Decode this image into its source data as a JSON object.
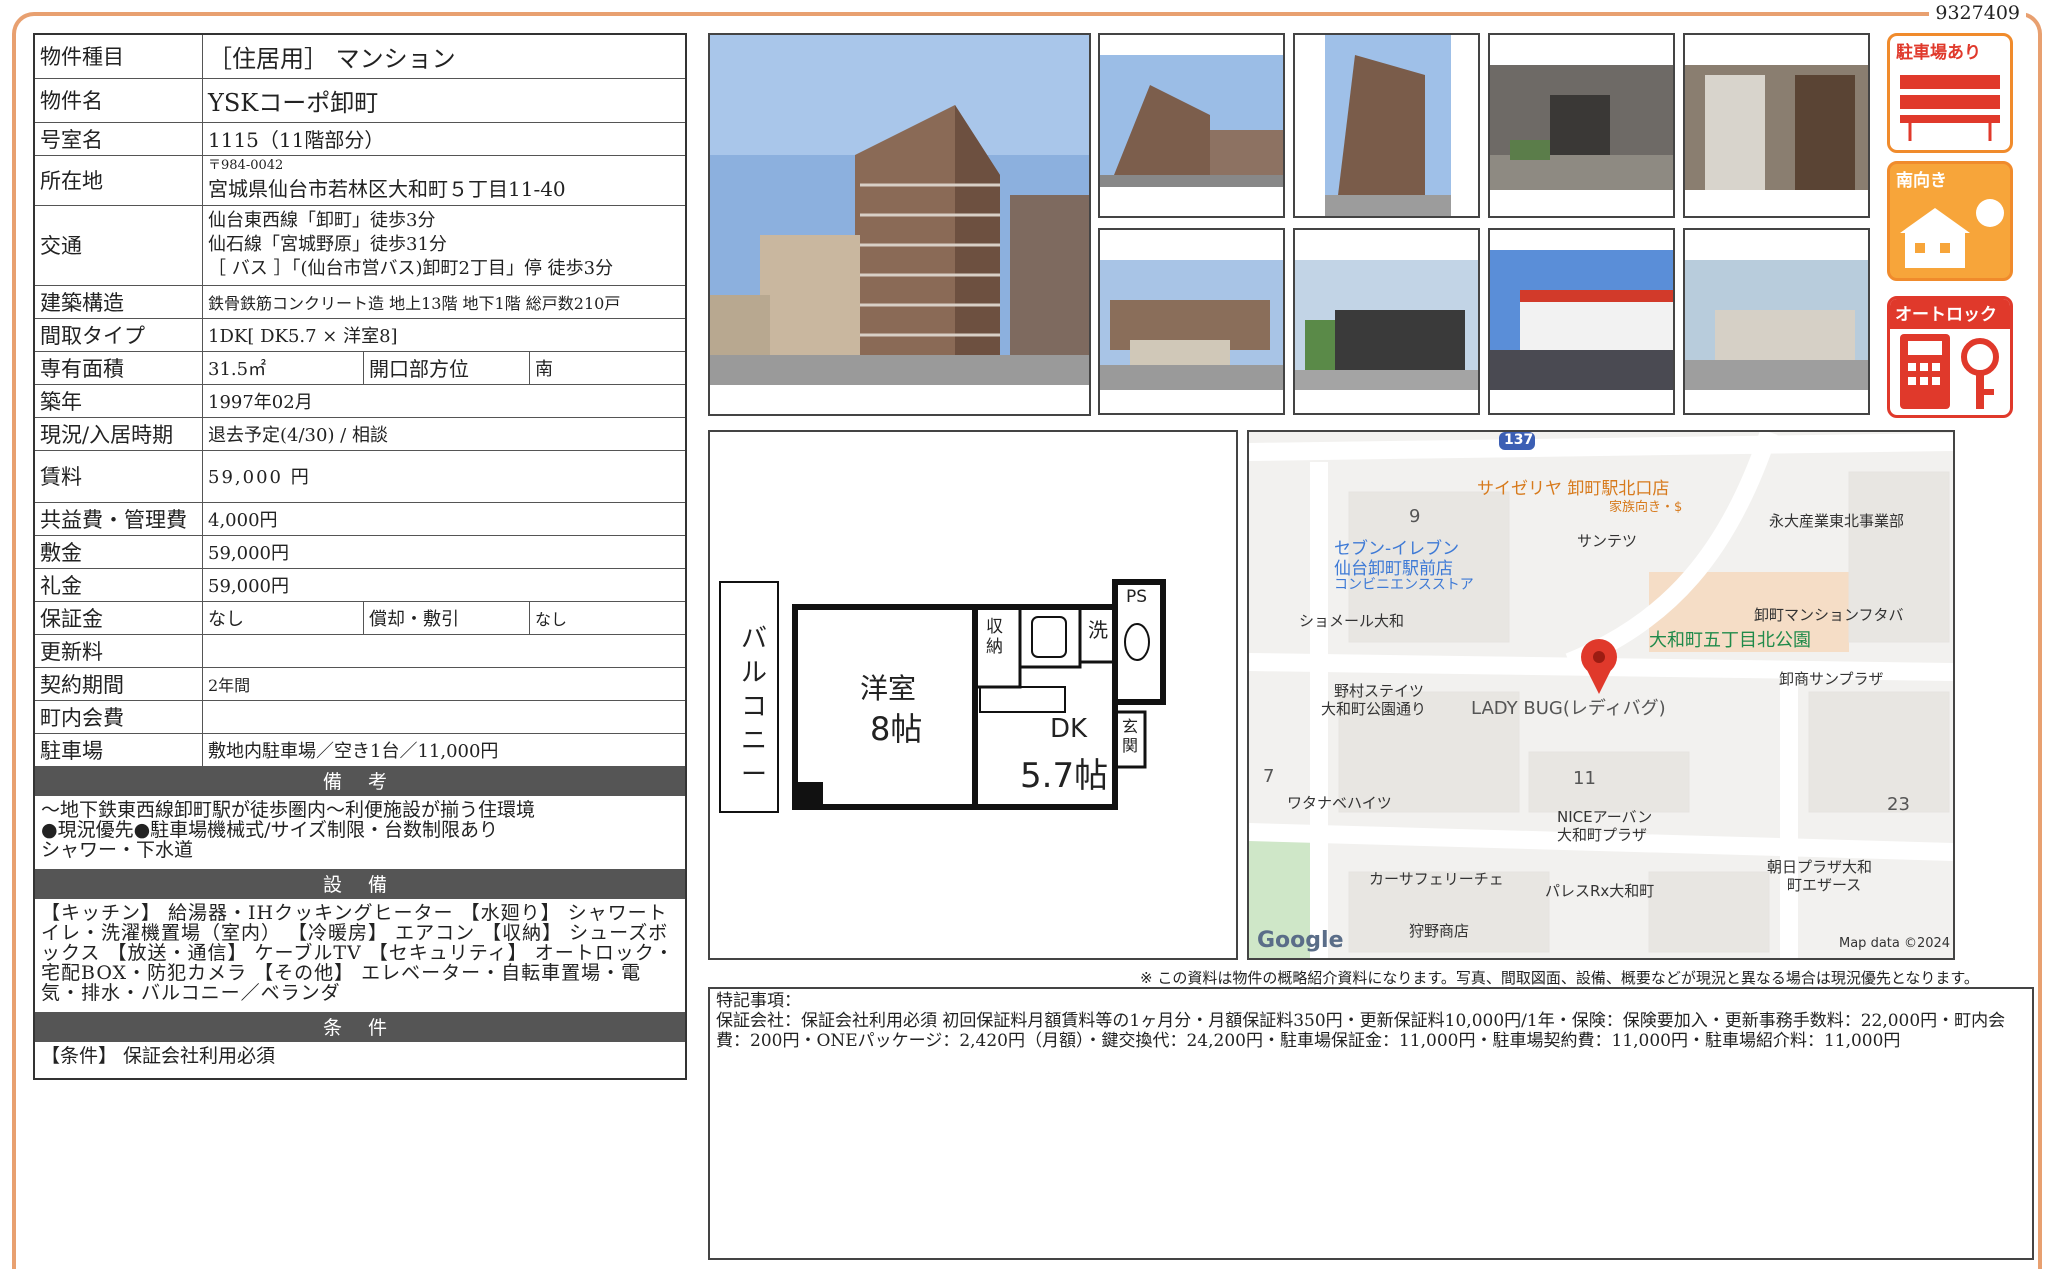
{
  "doc_id": "9327409",
  "property": {
    "rows": {
      "type": {
        "label": "物件種目",
        "value": "［住居用］ マンション"
      },
      "name": {
        "label": "物件名",
        "value": "YSKコーポ卸町"
      },
      "room": {
        "label": "号室名",
        "value": "1115（11階部分）"
      },
      "address": {
        "label": "所在地",
        "postal": "〒984-0042",
        "value": "宮城県仙台市若林区大和町５丁目11-40"
      },
      "transit": {
        "label": "交通",
        "lines": [
          "仙台東西線「卸町」徒歩3分",
          "仙石線「宮城野原」徒歩31分",
          "［ バス ］「(仙台市営バス)卸町2丁目」停 徒歩3分"
        ]
      },
      "structure": {
        "label": "建築構造",
        "value": "鉄骨鉄筋コンクリート造 地上13階 地下1階 総戸数210戸"
      },
      "layout": {
        "label": "間取タイプ",
        "value": "1DK[ DK5.7 × 洋室8]"
      },
      "area": {
        "label": "専有面積",
        "value": "31.5㎡",
        "sub_label": "開口部方位",
        "sub_value": "南"
      },
      "built": {
        "label": "築年",
        "value": "1997年02月"
      },
      "status": {
        "label": "現況/入居時期",
        "value": "退去予定(4/30) / 相談"
      },
      "rent": {
        "label": "賃料",
        "value": "59,000 円"
      },
      "fee": {
        "label": "共益費・管理費",
        "value": "4,000円"
      },
      "deposit": {
        "label": "敷金",
        "value": "59,000円"
      },
      "key_money": {
        "label": "礼金",
        "value": "59,000円"
      },
      "guarantee": {
        "label": "保証金",
        "value": "なし",
        "sub_label": "償却・敷引",
        "sub_value": "なし"
      },
      "renewal": {
        "label": "更新料",
        "value": ""
      },
      "term": {
        "label": "契約期間",
        "value": "2年間"
      },
      "town_fee": {
        "label": "町内会費",
        "value": ""
      },
      "parking": {
        "label": "駐車場",
        "value": "敷地内駐車場／空き1台／11,000円"
      }
    },
    "remarks_head": "備 考",
    "remarks": [
      "〜地下鉄東西線卸町駅が徒歩圏内〜利便施設が揃う住環境",
      "●現況優先●駐車場機械式/サイズ制限・台数制限あり",
      "シャワー・下水道"
    ],
    "equipment_head": "設 備",
    "equipment": "【キッチン】 給湯器・IHクッキングヒーター 【水廻り】 シャワートイレ・洗濯機置場（室内） 【冷暖房】 エアコン 【収納】 シューズボックス 【放送・通信】 ケーブルTV 【セキュリティ】 オートロック・宅配BOX・防犯カメラ 【その他】 エレベーター・自転車置場・電気・排水・バルコニー／ベランダ",
    "conditions_head": "条 件",
    "conditions": "【条件】 保証会社利用必須"
  },
  "icons": {
    "parking": {
      "title": "駐車場あり",
      "icon": "parking-lot-icon"
    },
    "south": {
      "title": "南向き",
      "icon": "south-facing-icon"
    },
    "autolock": {
      "title": "オートロック",
      "icon": "autolock-icon"
    }
  },
  "floorplan": {
    "balcony": "バルコニー",
    "western": "洋室",
    "western_size": "8帖",
    "dk": "DK",
    "dk_size": "5.7帖",
    "storage": "収納",
    "wash": "洗",
    "ps": "PS",
    "entrance": "玄関"
  },
  "map": {
    "route": "137",
    "labels": {
      "saizeriya": "サイゼリヤ 卸町駅北口店",
      "saizeriya_sub": "家族向き・$",
      "seven_a": "セブン-イレブン",
      "seven_b": "仙台卸町駅前店",
      "seven_c": "コンビニエンスストア",
      "santetsu": "サンテツ",
      "eidai": "永大産業東北事業部",
      "shomer": "ショメール大和",
      "oroshi_mansion": "卸町マンションフタバ",
      "park": "大和町五丁目北公園",
      "nomura_a": "野村ステイツ",
      "nomura_b": "大和町公園通り",
      "ladybug": "LADY BUG(レディバグ)",
      "oroshi_sun": "卸商サンプラザ",
      "watanabe": "ワタナベハイツ",
      "nice_a": "NICEアーバン",
      "nice_b": "大和町プラザ",
      "asahi_a": "朝日プラザ大和",
      "asahi_b": "町エザース",
      "carsafe": "カーサフェリーチェ",
      "palace": "パレスRx大和町",
      "kano": "狩野商店",
      "n9": "9",
      "n7": "7",
      "n11": "11",
      "n23": "23",
      "google": "Google",
      "mapdata": "Map data ©2024"
    }
  },
  "note": "※ この資料は物件の概略紹介資料になります。写真、間取図面、設備、概要などが現況と異なる場合は現況優先となります。",
  "special": {
    "title": "特記事項：",
    "text": "保証会社：保証会社利用必須 初回保証料月額賃料等の1ヶ月分・月額保証料350円・更新保証料10,000円/1年・保険：保険要加入・更新事務手数料：22,000円・町内会費：200円・ONEパッケージ：2,420円（月額）・鍵交換代：24,200円・駐車場保証金：11,000円・駐車場契約費：11,000円・駐車場紹介料：11,000円"
  }
}
